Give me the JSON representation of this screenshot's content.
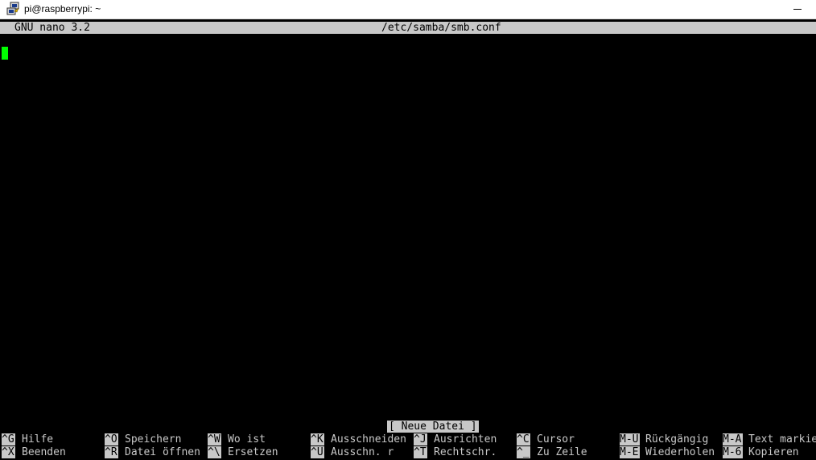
{
  "window": {
    "title": "pi@raspberrypi: ~",
    "icon": "putty-icon"
  },
  "nano": {
    "version_label": "GNU nano 3.2",
    "filename": "/etc/samba/smb.conf",
    "status_message": "[ Neue Datei ]",
    "cursor_color": "#00ff00"
  },
  "shortcuts_row1": [
    {
      "key": "^G",
      "label": "Hilfe"
    },
    {
      "key": "^O",
      "label": "Speichern"
    },
    {
      "key": "^W",
      "label": "Wo ist"
    },
    {
      "key": "^K",
      "label": "Ausschneiden"
    },
    {
      "key": "^J",
      "label": "Ausrichten"
    },
    {
      "key": "^C",
      "label": "Cursor"
    },
    {
      "key": "M-U",
      "label": "Rückgängig"
    },
    {
      "key": "M-A",
      "label": "Text markie"
    }
  ],
  "shortcuts_row2": [
    {
      "key": "^X",
      "label": "Beenden"
    },
    {
      "key": "^R",
      "label": "Datei öffnen"
    },
    {
      "key": "^\\",
      "label": "Ersetzen"
    },
    {
      "key": "^U",
      "label": "Ausschn. r"
    },
    {
      "key": "^T",
      "label": "Rechtschr."
    },
    {
      "key": "^_",
      "label": "Zu Zeile"
    },
    {
      "key": "M-E",
      "label": "Wiederholen"
    },
    {
      "key": "M-6",
      "label": "Kopieren"
    }
  ]
}
